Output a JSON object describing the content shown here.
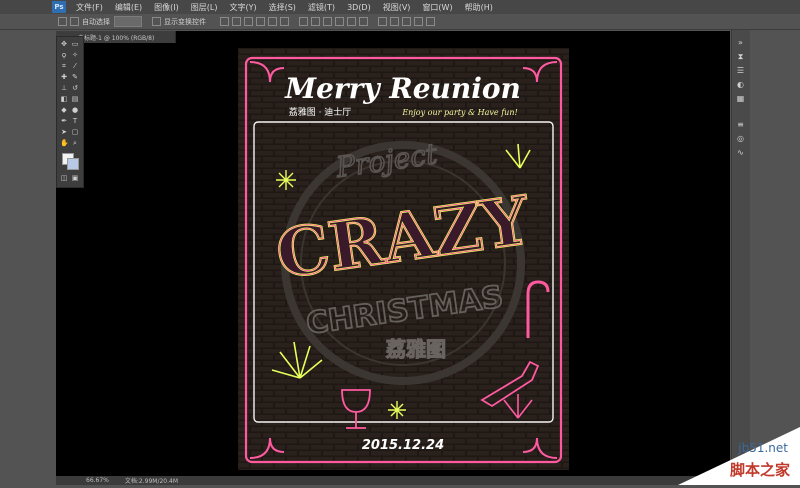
{
  "app": {
    "logo_text": "Ps"
  },
  "menu": [
    "文件(F)",
    "编辑(E)",
    "图像(I)",
    "图层(L)",
    "文字(Y)",
    "选择(S)",
    "滤镜(T)",
    "3D(D)",
    "视图(V)",
    "窗口(W)",
    "帮助(H)"
  ],
  "options": {
    "auto_select_label": "自动选择",
    "transform_label": "显示变换控件"
  },
  "document": {
    "tab_title": "未标题-1 @ 100% (RGB/8)"
  },
  "status": {
    "zoom": "66.67%",
    "doc_size": "文档:2.99M/20.4M"
  },
  "poster": {
    "title": "Merry Reunion",
    "subtitle_cn": "荔雅图 · 迪士厅",
    "tagline": "Enjoy our party & Have fun!",
    "script_word": "Project",
    "headline": "CRAZY",
    "subheadline": "CHRISTMAS",
    "stamp_cn": "荔雅图",
    "date": "2015.12.24"
  },
  "watermark": {
    "site": "jb51.net",
    "name_cn": "脚本之家"
  },
  "colors": {
    "neon_pink": "#ff5aa0",
    "neon_yellow": "#e7ff5a",
    "neon_cyan": "#6fe6ff",
    "panel": "#535353"
  }
}
